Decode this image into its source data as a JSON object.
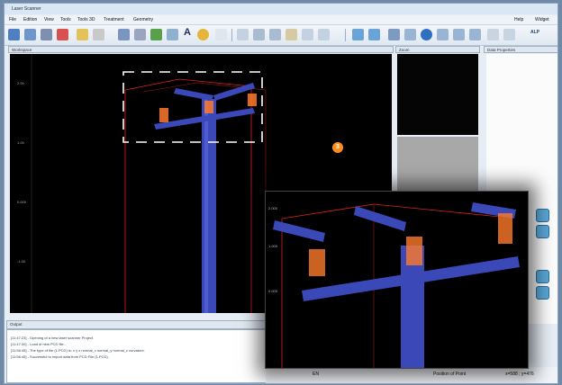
{
  "window": {
    "title": "Laser Scanner"
  },
  "menu": {
    "items": [
      "File",
      "Edition",
      "View",
      "Tools",
      "Tools 3D",
      "Treatment",
      "Geometry"
    ],
    "right_items": [
      "Help",
      "Widget"
    ]
  },
  "toolbar": {
    "alp_label": "ALP"
  },
  "panels": {
    "workspace": "Workspace",
    "zoom": "Zoom",
    "data_properties": "Data Properties",
    "output": "Output"
  },
  "workspace_axis": {
    "ticks": [
      "2.00",
      "1.00",
      "0.000",
      "-1.00"
    ]
  },
  "marker": {
    "number": "3"
  },
  "output_lines": [
    "[11:47:23] - Opening of a new laser scanner Project.",
    "[11:47:30] - Load of new PCD file...",
    "[11:56:45] - The type of file (1.PCD) is: x y z normal_x normal_y normal_z curvature.",
    "[11:56:45] - Successful to import data from PCD File (1.PCD)."
  ],
  "inset_axis": {
    "ticks": [
      "2.000",
      "1.000",
      "0.000"
    ]
  },
  "statusbar": {
    "mode": "EN",
    "label": "Position of Point",
    "coords": "x=588 ; y=476"
  },
  "colors": {
    "pole": "#3b48b8",
    "pole_light": "#5a6be0",
    "bbox": "#ff2a2a",
    "insulator": "#ff7a2a",
    "marker": "#ff8c1a"
  }
}
